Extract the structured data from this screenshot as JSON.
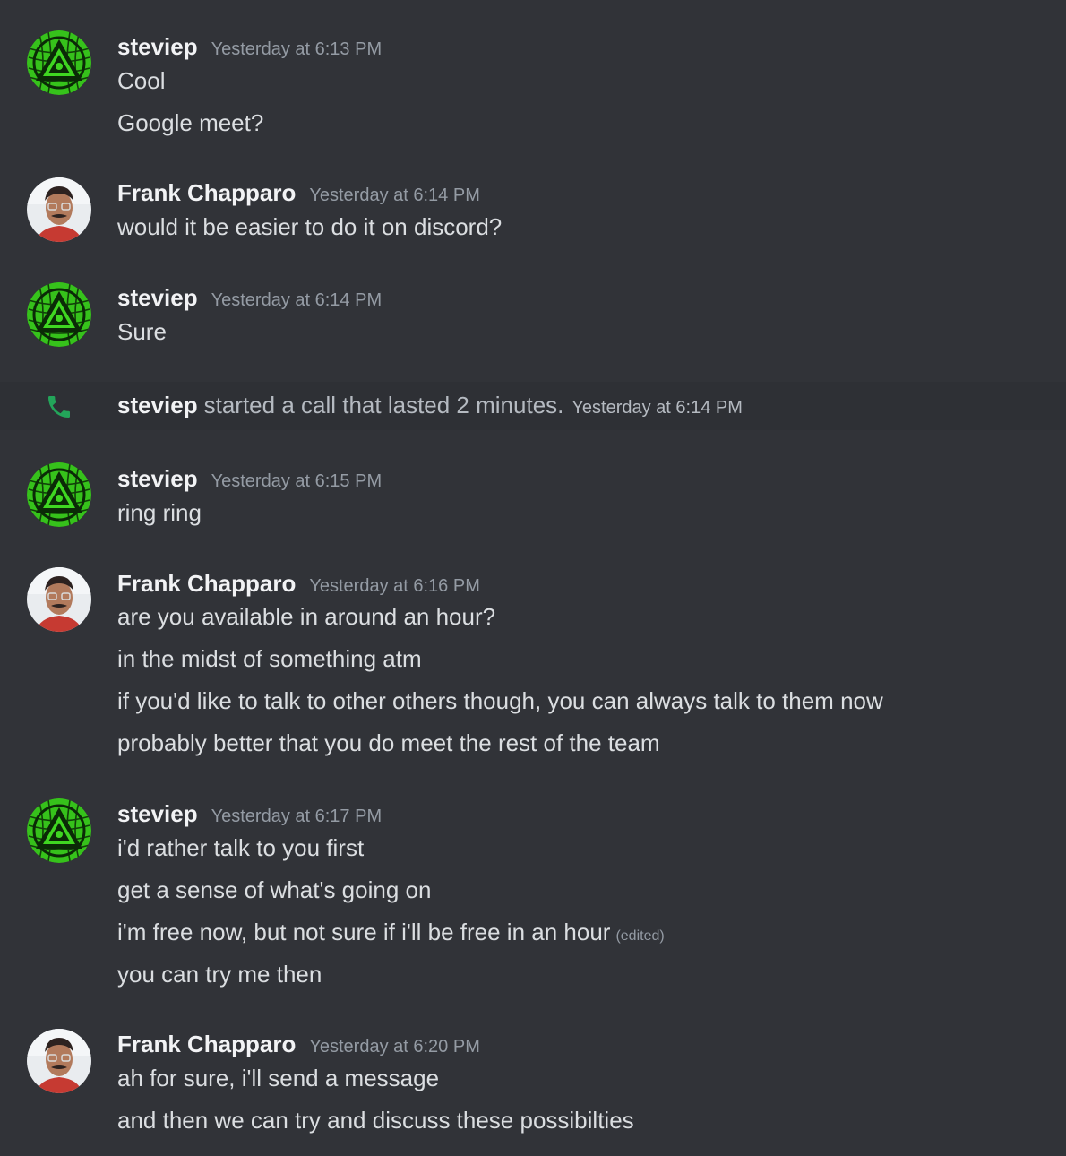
{
  "colors": {
    "background": "#313338",
    "call_row_background": "#2e3035",
    "username": "#f2f3f5",
    "message_text": "#dbdee1",
    "timestamp": "#949ba4",
    "call_icon": "#23a55a"
  },
  "messages": [
    {
      "author": "steviep",
      "avatar": "green-triangle-emblem-avatar",
      "timestamp": "Yesterday at 6:13 PM",
      "lines": [
        "Cool",
        "Google meet?"
      ]
    },
    {
      "author": "Frank Chapparo",
      "avatar": "portrait-photo-avatar",
      "timestamp": "Yesterday at 6:14 PM",
      "lines": [
        "would it be easier to do it on discord?"
      ]
    },
    {
      "author": "steviep",
      "avatar": "green-triangle-emblem-avatar",
      "timestamp": "Yesterday at 6:14 PM",
      "lines": [
        "Sure"
      ]
    }
  ],
  "call_event": {
    "icon": "phone-icon",
    "user": "steviep",
    "description": "started a call that lasted 2 minutes.",
    "timestamp": "Yesterday at 6:14 PM"
  },
  "messages_after": [
    {
      "author": "steviep",
      "avatar": "green-triangle-emblem-avatar",
      "timestamp": "Yesterday at 6:15 PM",
      "lines": [
        "ring ring"
      ]
    },
    {
      "author": "Frank Chapparo",
      "avatar": "portrait-photo-avatar",
      "timestamp": "Yesterday at 6:16 PM",
      "lines": [
        "are you available in around an hour?",
        "in the midst of something atm",
        "if you'd like to talk to other others though, you can always talk to them now",
        "probably better that you do meet the rest of the team"
      ]
    },
    {
      "author": "steviep",
      "avatar": "green-triangle-emblem-avatar",
      "timestamp": "Yesterday at 6:17 PM",
      "lines": [
        "i'd rather talk to you first",
        "get a sense of what's going on",
        "i'm free now, but not sure if i'll be free in an hour",
        "you can try me then"
      ],
      "edited_label": "(edited)"
    },
    {
      "author": "Frank Chapparo",
      "avatar": "portrait-photo-avatar",
      "timestamp": "Yesterday at 6:20 PM",
      "lines": [
        "ah for sure, i'll send a message",
        "and then we can try and discuss these possibilties"
      ]
    }
  ]
}
